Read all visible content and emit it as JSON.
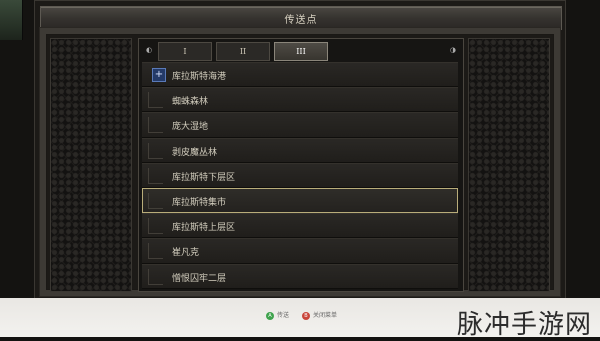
{
  "title": "传送点",
  "tabs": [
    {
      "label": "I",
      "active": false
    },
    {
      "label": "II",
      "active": false
    },
    {
      "label": "III",
      "active": true
    }
  ],
  "waypoints": [
    {
      "label": "库拉斯特海港",
      "current": true
    },
    {
      "label": "蜘蛛森林"
    },
    {
      "label": "庞大湿地"
    },
    {
      "label": "剥皮魔丛林"
    },
    {
      "label": "库拉斯特下层区"
    },
    {
      "label": "库拉斯特集市",
      "selected": true
    },
    {
      "label": "库拉斯特上层区"
    },
    {
      "label": "崔凡克"
    },
    {
      "label": "憎恨囚牢二层"
    }
  ],
  "hints": {
    "confirm": {
      "button": "A",
      "label": "传送"
    },
    "close": {
      "button": "B",
      "label": "关闭菜单"
    }
  },
  "watermark": "脉冲手游网",
  "colors": {
    "selection_border": "#b9ad7a",
    "current_marker": "#243a68",
    "button_a": "#3fa34d",
    "button_b": "#c9453a"
  }
}
